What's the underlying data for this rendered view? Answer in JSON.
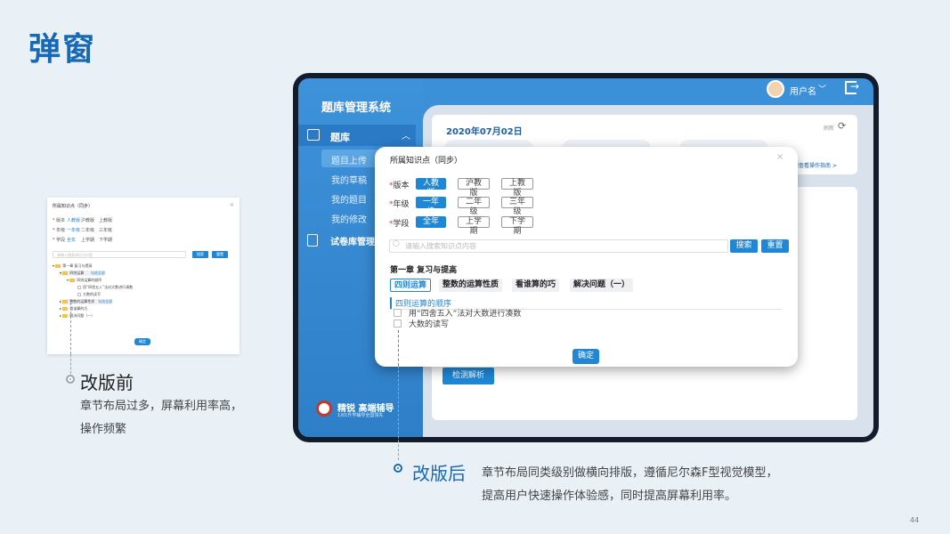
{
  "page": {
    "title": "弹窗",
    "page_number": "44"
  },
  "before": {
    "title": "改版前",
    "desc_lines": [
      "章节布局过多，屏幕利用率高，",
      "操作频繁"
    ]
  },
  "after": {
    "title": "改版后",
    "desc_lines": [
      "章节布局同类级别做横向排版，遵循尼尔森F型视觉模型，",
      "提高用户快速操作体验感，同时提高屏幕利用率。"
    ]
  },
  "mini": {
    "title": "所属知识点（同步）",
    "close": "×",
    "row_labels": [
      "* 版本",
      "* 年级",
      "* 学段"
    ],
    "edition_options": [
      "人教版",
      "沪教版",
      "上教版"
    ],
    "grade_options": [
      "一年级",
      "二年级",
      "三年级"
    ],
    "stage_options": [
      "全年",
      "上学期",
      "下学期"
    ],
    "search_placeholder": "请输入搜索知识点内容",
    "search_btn": "搜索",
    "reset_btn": "重置",
    "tree": [
      "第一章 复习与提高",
      "四则运算",
      "勾选全部",
      "四则运算的顺序",
      "用“四舍五入”法对大数进行凑数",
      "大数的读写",
      "整数的运算性质",
      "勾选全部",
      "看谁算的巧",
      "解决问题（一）"
    ],
    "ok": "确定"
  },
  "app": {
    "system_name": "题库管理系统",
    "menu_question_bank": "题库",
    "menu_chevron": "︿",
    "submenu": [
      "题目上传",
      "我的草稿",
      "我的题目",
      "我的修改"
    ],
    "menu_paper_bank": "试卷库管理",
    "brand_main": "精锐 高端辅导",
    "brand_sub": "1对1升学辅导全国领先",
    "username": "用户名",
    "user_chevron": "﹀",
    "exit_icon_arrow": "→",
    "date": "2020年07月02日",
    "refresh_label": "刷新",
    "refresh_icon": "⟳",
    "guide_link": "学习查看操作指南 >",
    "detect_button": "检测解析"
  },
  "modal": {
    "title": "所属知识点（同步）",
    "close": "×",
    "edition_label": "版本",
    "grade_label": "年级",
    "stage_label": "学段",
    "required_mark": "*",
    "edition_options": [
      "人教版",
      "沪教版",
      "上教版"
    ],
    "grade_options": [
      "一年级",
      "二年级",
      "三年级"
    ],
    "stage_options": [
      "全年",
      "上学期",
      "下学期"
    ],
    "search_placeholder": "请输入搜索知识点内容",
    "search_button": "搜索",
    "reset_button": "重置",
    "chapter_title": "第一章 复习与提高",
    "tabs": [
      "四则运算",
      "整数的运算性质",
      "看谁算的巧",
      "解决问题（一）"
    ],
    "section_title": "四则运算的顺序",
    "items": [
      "用“四舍五入”法对大数进行凑数",
      "大数的读写"
    ],
    "ok_button": "确定"
  }
}
